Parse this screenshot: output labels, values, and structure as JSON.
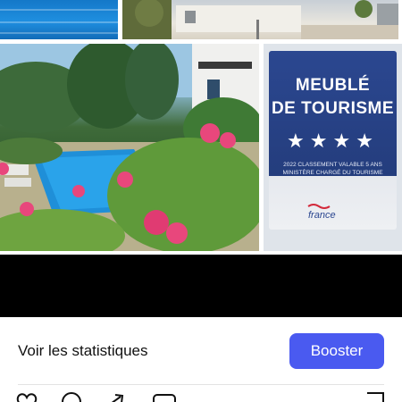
{
  "post": {
    "photos": [
      {
        "name": "pool-top"
      },
      {
        "name": "villa-top"
      },
      {
        "name": "pool-garden"
      },
      {
        "name": "certificate"
      }
    ],
    "certificate": {
      "line1": "MEUBLÉ",
      "line2": "DE TOURISME",
      "stars": "★★★★",
      "small_line1": "2022 CLASSEMENT VALABLE 5 ANS",
      "small_line2": "MINISTÈRE CHARGÉ DU TOURISME",
      "logo_text": "france"
    }
  },
  "actions": {
    "stats_label": "Voir les statistiques",
    "boost_label": "Booster",
    "boost_color": "#4a5af0"
  },
  "icon_bar": {
    "icons": [
      "heart-icon",
      "comment-icon",
      "share-icon",
      "message-icon",
      "bookmark-icon"
    ]
  }
}
